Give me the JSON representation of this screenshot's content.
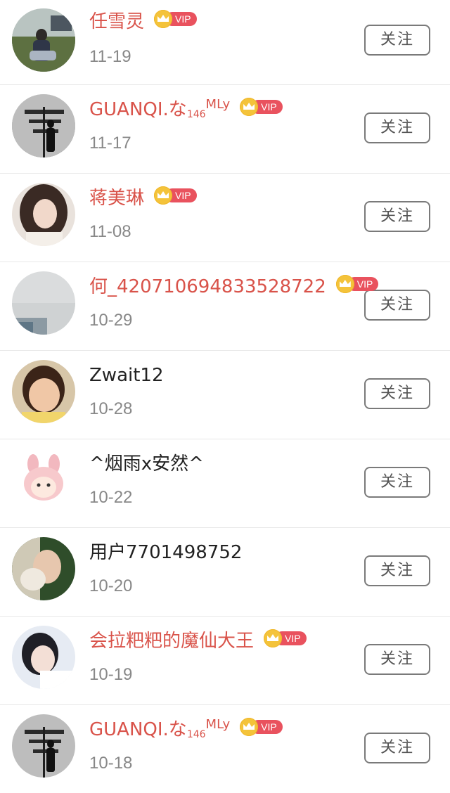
{
  "follow_label": "关注",
  "vip_label": "VIP",
  "users": [
    {
      "name": "任雪灵",
      "date": "11-19",
      "vip": true
    },
    {
      "name": "GUANQI.な",
      "name_sub": "146",
      "name_suffix": "MLy",
      "date": "11-17",
      "vip": true
    },
    {
      "name": "蒋美琳",
      "date": "11-08",
      "vip": true
    },
    {
      "name": "何_420710694833528722",
      "date": "10-29",
      "vip": true
    },
    {
      "name": "Zwait12",
      "date": "10-28",
      "vip": false
    },
    {
      "name": "^烟雨x安然^",
      "date": "10-22",
      "vip": false
    },
    {
      "name": "用户7701498752",
      "date": "10-20",
      "vip": false
    },
    {
      "name": "会拉粑粑的魔仙大王",
      "date": "10-19",
      "vip": true
    },
    {
      "name": "GUANQI.な",
      "name_sub": "146",
      "name_suffix": "MLy",
      "date": "10-18",
      "vip": true
    }
  ],
  "colors": {
    "vip_name": "#d9534a",
    "normal_name": "#222222",
    "date": "#888888",
    "vip_badge": "#e9525e",
    "crown": "#f4c33a"
  }
}
